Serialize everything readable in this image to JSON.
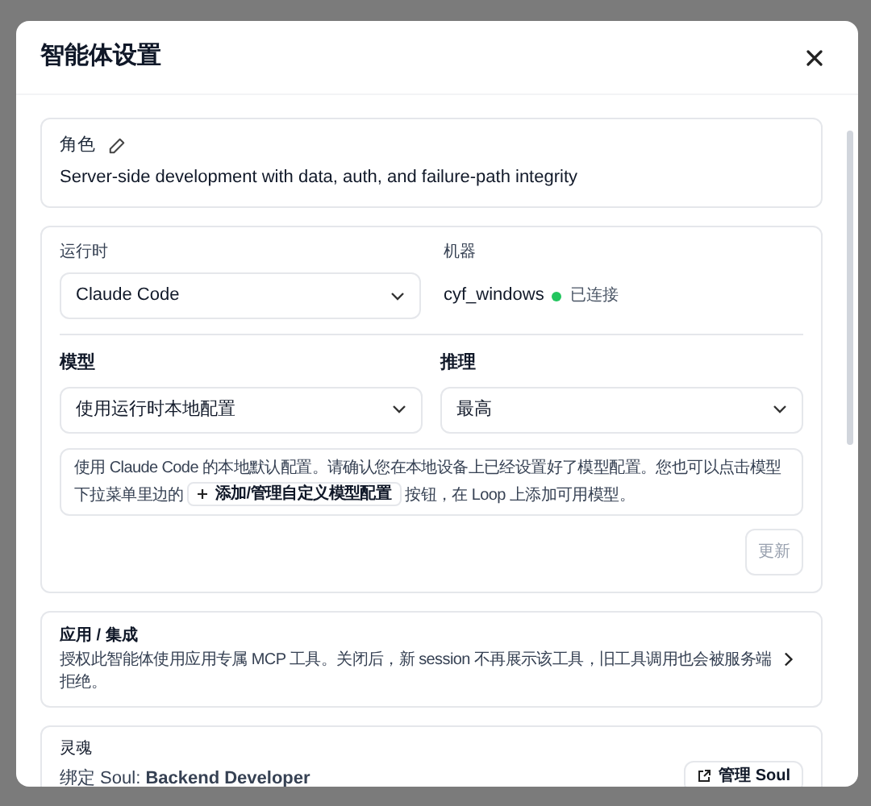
{
  "dialog": {
    "title": "智能体设置"
  },
  "role": {
    "label": "角色",
    "text": "Server-side development with data, auth, and failure-path integrity"
  },
  "runtime": {
    "label": "运行时",
    "value": "Claude Code"
  },
  "machine": {
    "label": "机器",
    "name": "cyf_windows",
    "status": "已连接",
    "color": "#22c55e"
  },
  "model": {
    "label": "模型",
    "value": "使用运行时本地配置"
  },
  "reasoning": {
    "label": "推理",
    "value": "最高"
  },
  "note": {
    "before": "使用 Claude Code 的本地默认配置。请确认您在本地设备上已经设置好了模型配置。您也可以点击模型下拉菜单里边的",
    "button": "添加/管理自定义模型配置",
    "after": "按钮，在 Loop 上添加可用模型。"
  },
  "update_button": {
    "label": "更新",
    "disabled": true
  },
  "apps": {
    "title": "应用 / 集成",
    "description": "授权此智能体使用应用专属 MCP 工具。关闭后，新 session 不再展示该工具，旧工具调用也会被服务端拒绝。"
  },
  "soul": {
    "label": "灵魂",
    "binding": "绑定 Soul: **Backend Developer**",
    "button": "管理 Soul"
  }
}
